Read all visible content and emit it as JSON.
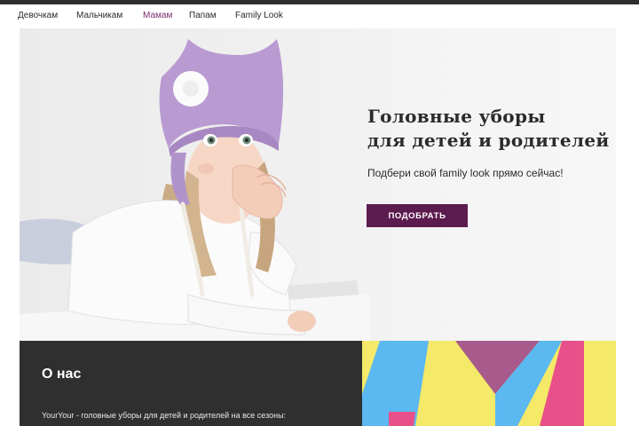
{
  "nav": {
    "items": [
      {
        "label": "Девочкам"
      },
      {
        "label": "Мальчикам"
      },
      {
        "label": "Мамам"
      },
      {
        "label": "Папам"
      },
      {
        "label": "Family Look"
      }
    ]
  },
  "hero": {
    "title_line1": "Головные уборы",
    "title_line2": "для детей и родителей",
    "subtitle": "Подбери свой family look прямо сейчас!",
    "button_label": "ПОДОБРАТЬ"
  },
  "about": {
    "title": "О нас",
    "text": "YourYour - головные уборы для детей и родителей на все сезоны:"
  },
  "colors": {
    "accent": "#5c1b4f",
    "active_nav": "#7b2d6e",
    "dark_panel": "#2f2f2f",
    "art_yellow": "#f4e968",
    "art_blue": "#5bb8f0",
    "art_pink": "#e8508a",
    "art_purple": "#a85a8c"
  }
}
